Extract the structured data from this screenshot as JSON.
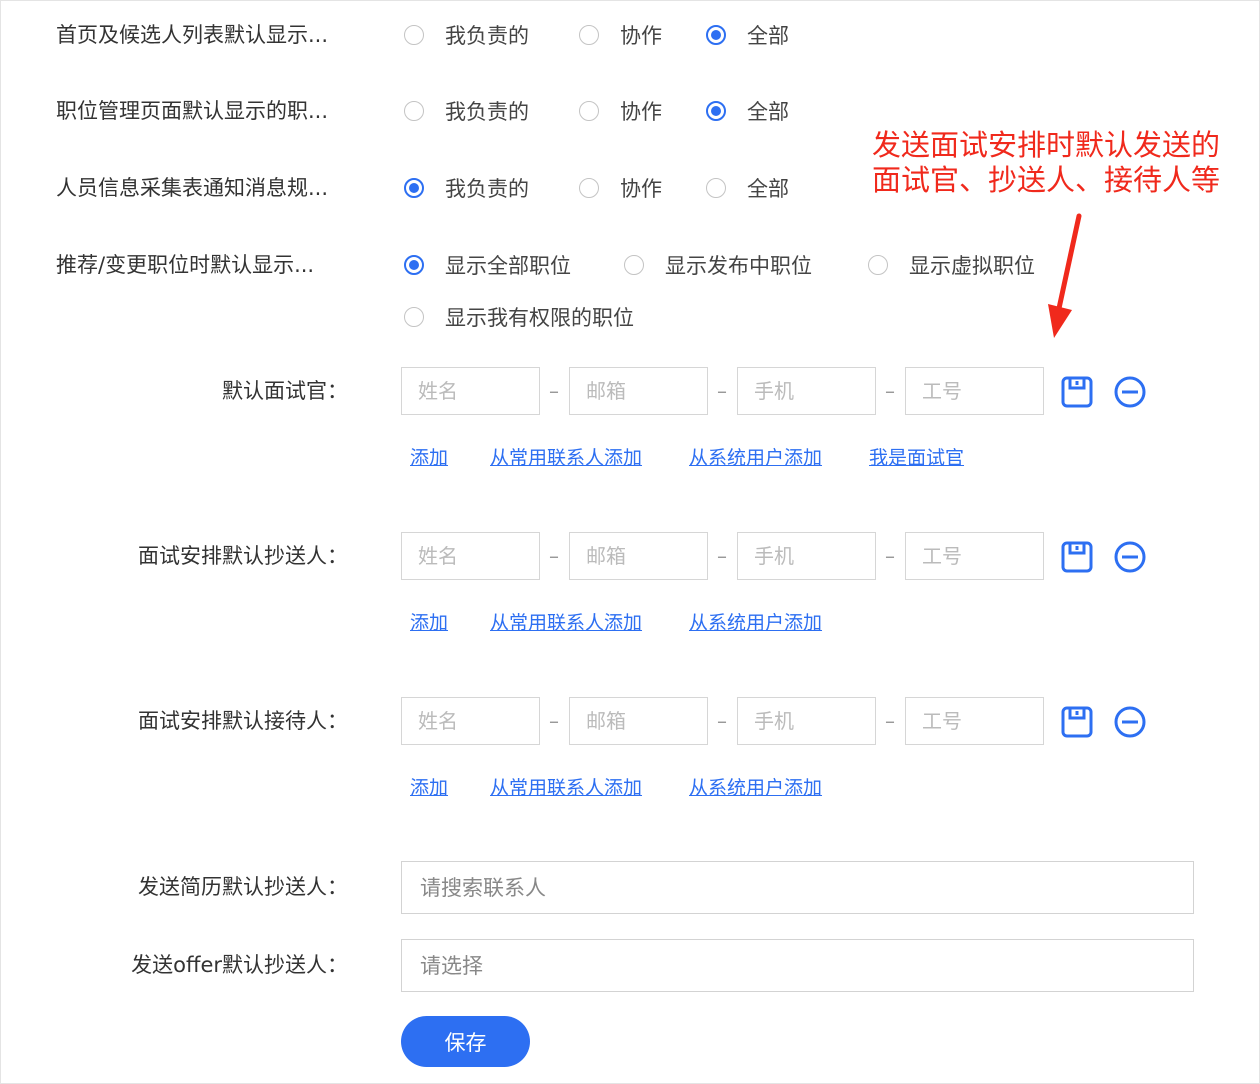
{
  "settings": [
    {
      "label": "首页及候选人列表默认显示...",
      "options": [
        {
          "label": "我负责的",
          "selected": false
        },
        {
          "label": "协作",
          "selected": false
        },
        {
          "label": "全部",
          "selected": true
        }
      ]
    },
    {
      "label": "职位管理页面默认显示的职...",
      "options": [
        {
          "label": "我负责的",
          "selected": false
        },
        {
          "label": "协作",
          "selected": false
        },
        {
          "label": "全部",
          "selected": true
        }
      ]
    },
    {
      "label": "人员信息采集表通知消息规...",
      "options": [
        {
          "label": "我负责的",
          "selected": true
        },
        {
          "label": "协作",
          "selected": false
        },
        {
          "label": "全部",
          "selected": false
        }
      ]
    },
    {
      "label": "推荐/变更职位时默认显示...",
      "options": [
        {
          "label": "显示全部职位",
          "selected": true
        },
        {
          "label": "显示发布中职位",
          "selected": false
        },
        {
          "label": "显示虚拟职位",
          "selected": false
        },
        {
          "label": "显示我有权限的职位",
          "selected": false
        }
      ]
    }
  ],
  "contact_fields": {
    "name_placeholder": "姓名",
    "email_placeholder": "邮箱",
    "phone_placeholder": "手机",
    "id_placeholder": "工号",
    "separator": "–"
  },
  "contact_groups": [
    {
      "label": "默认面试官：",
      "links": [
        "添加",
        "从常用联系人添加",
        "从系统用户添加",
        "我是面试官"
      ]
    },
    {
      "label": "面试安排默认抄送人：",
      "links": [
        "添加",
        "从常用联系人添加",
        "从系统用户添加"
      ]
    },
    {
      "label": "面试安排默认接待人：",
      "links": [
        "添加",
        "从常用联系人添加",
        "从系统用户添加"
      ]
    }
  ],
  "resume_cc": {
    "label": "发送简历默认抄送人：",
    "placeholder": "请搜索联系人"
  },
  "offer_cc": {
    "label": "发送offer默认抄送人：",
    "placeholder": "请选择"
  },
  "save_button": "保存",
  "annotation": {
    "line1": "发送面试安排时默认发送的",
    "line2": "面试官、抄送人、接待人等",
    "color": "#f0291c"
  },
  "colors": {
    "accent": "#2d6ff2",
    "link": "#2d6ff2",
    "annotation": "#f0291c"
  },
  "icons": {
    "save": "save-icon",
    "remove": "minus-circle-icon"
  }
}
